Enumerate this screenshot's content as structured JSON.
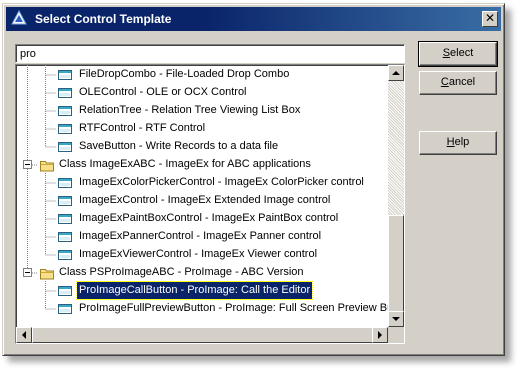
{
  "window": {
    "title": "Select Control Template",
    "close_glyph": "✕"
  },
  "search": {
    "value": "pro"
  },
  "tree": {
    "rows": [
      {
        "kind": "item",
        "text": "FileDropCombo - File-Loaded Drop Combo"
      },
      {
        "kind": "item",
        "text": "OLEControl - OLE or OCX Control"
      },
      {
        "kind": "item",
        "text": "RelationTree - Relation Tree Viewing List Box"
      },
      {
        "kind": "item",
        "text": "RTFControl - RTF Control"
      },
      {
        "kind": "item",
        "text": "SaveButton - Write Records to a data file"
      },
      {
        "kind": "class",
        "text": "Class ImageExABC - ImageEx for ABC applications"
      },
      {
        "kind": "item",
        "text": "ImageExColorPickerControl - ImageEx ColorPicker control"
      },
      {
        "kind": "item",
        "text": "ImageExControl - ImageEx Extended Image control"
      },
      {
        "kind": "item",
        "text": "ImageExPaintBoxControl - ImageEx PaintBox control"
      },
      {
        "kind": "item",
        "text": "ImageExPannerControl - ImageEx Panner control"
      },
      {
        "kind": "item",
        "text": "ImageExViewerControl - ImageEx Viewer control"
      },
      {
        "kind": "class",
        "text": "Class PSProImageABC - ProImage - ABC Version"
      },
      {
        "kind": "item",
        "text": "ProImageCallButton - ProImage: Call the Editor",
        "selected": true
      },
      {
        "kind": "item",
        "text": "ProImageFullPreviewButton - ProImage: Full Screen Preview Butt"
      }
    ]
  },
  "buttons": {
    "select": {
      "label_ul": "S",
      "label_rest": "elect"
    },
    "cancel": {
      "label_ul": "C",
      "label_rest": "ancel"
    },
    "help": {
      "label_ul": "H",
      "label_rest": "elp"
    }
  },
  "icons": {
    "window": "app-icon",
    "class": "folder-icon",
    "item": "control-template-icon"
  },
  "colors": {
    "titlebar": "#0a246a",
    "selection": "#0a246a",
    "face": "#d4d0c8"
  }
}
